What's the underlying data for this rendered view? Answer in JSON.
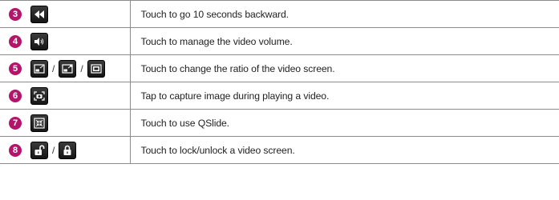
{
  "rows": [
    {
      "number": "3",
      "icons": [
        "rewind-icon"
      ],
      "description": "Touch to go 10 seconds backward."
    },
    {
      "number": "4",
      "icons": [
        "volume-icon"
      ],
      "description": "Touch to manage the video volume."
    },
    {
      "number": "5",
      "icons": [
        "ratio-shrink-icon",
        "ratio-expand-icon",
        "ratio-fit-icon"
      ],
      "separator": "/",
      "description": "Touch to change the ratio of the video screen."
    },
    {
      "number": "6",
      "icons": [
        "capture-icon"
      ],
      "description": "Tap to capture image during playing a video."
    },
    {
      "number": "7",
      "icons": [
        "qslide-icon"
      ],
      "description": "Touch to use QSlide."
    },
    {
      "number": "8",
      "icons": [
        "unlock-icon",
        "lock-icon"
      ],
      "separator": "/",
      "description": "Touch to lock/unlock a video screen."
    }
  ],
  "colors": {
    "badge": "#b4156b",
    "icon_bg": "#1f1f1f",
    "border": "#8c8c8c"
  }
}
